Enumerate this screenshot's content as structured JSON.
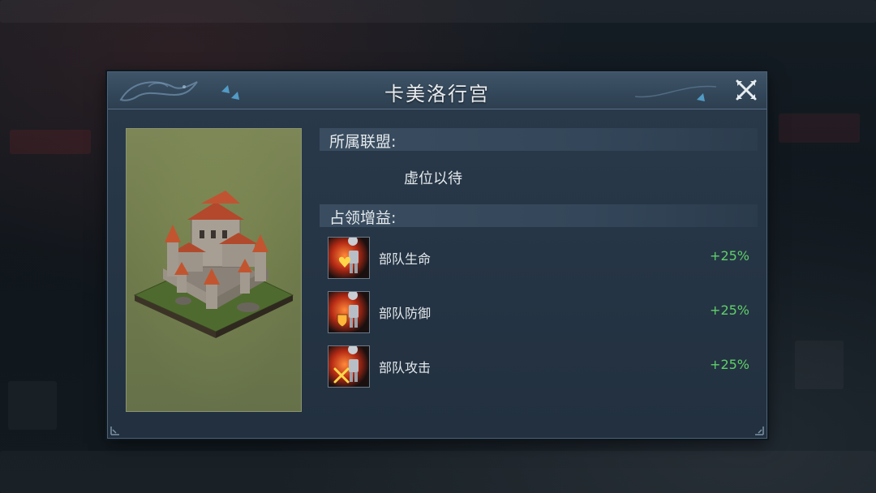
{
  "dialog": {
    "title": "卡美洛行宫"
  },
  "alliance": {
    "label": "所属联盟:",
    "value": "虚位以待"
  },
  "occupation": {
    "label": "占领增益:",
    "bonuses": [
      {
        "name": "部队生命",
        "value": "+25%",
        "icon": "troop-health-icon"
      },
      {
        "name": "部队防御",
        "value": "+25%",
        "icon": "troop-defense-icon"
      },
      {
        "name": "部队攻击",
        "value": "+25%",
        "icon": "troop-attack-icon"
      }
    ]
  },
  "colors": {
    "bonus_value": "#5fd06a",
    "dialog_bg": "#2a3a4a",
    "title_bar": "#3f5468",
    "icon_glow": "#e2562a"
  }
}
